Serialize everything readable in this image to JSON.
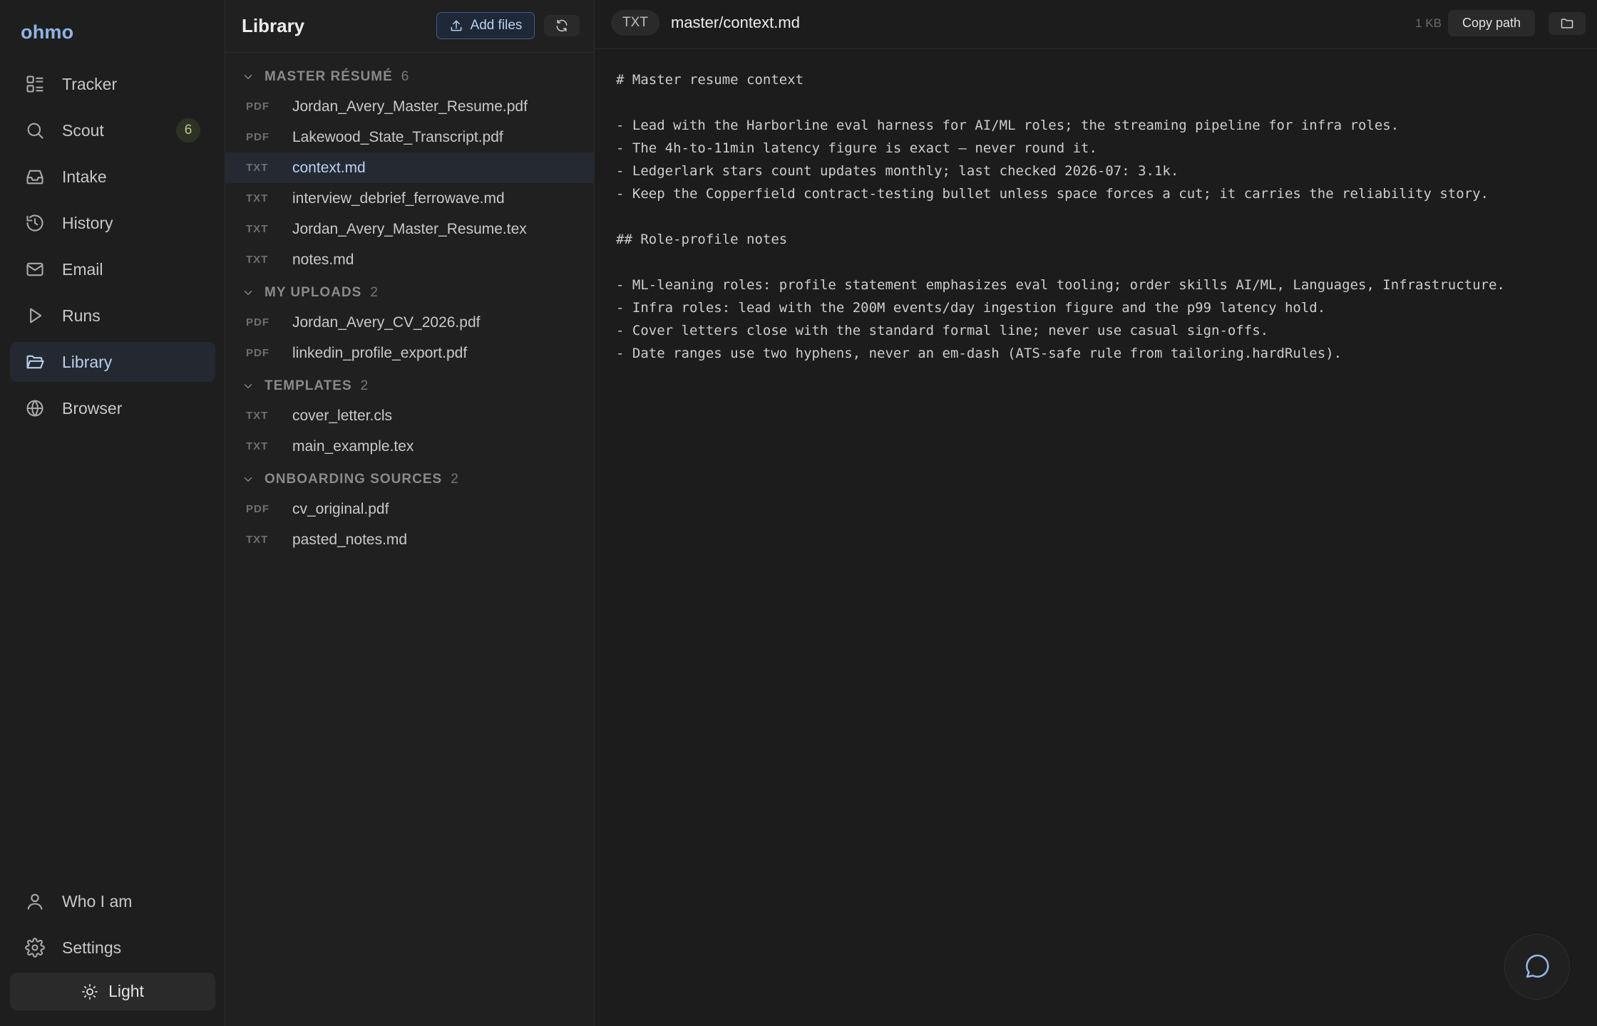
{
  "app": {
    "brand": "ohmo"
  },
  "nav": {
    "items": [
      {
        "label": "Tracker",
        "icon": "tracker-icon",
        "active": false
      },
      {
        "label": "Scout",
        "icon": "search-icon",
        "badge": "6",
        "active": false
      },
      {
        "label": "Intake",
        "icon": "inbox-icon",
        "active": false
      },
      {
        "label": "History",
        "icon": "history-icon",
        "active": false
      },
      {
        "label": "Email",
        "icon": "mail-icon",
        "active": false
      },
      {
        "label": "Runs",
        "icon": "play-icon",
        "active": false
      },
      {
        "label": "Library",
        "icon": "folder-open-icon",
        "active": true
      },
      {
        "label": "Browser",
        "icon": "globe-icon",
        "active": false
      }
    ],
    "bottom": [
      {
        "label": "Who I am",
        "icon": "user-icon"
      },
      {
        "label": "Settings",
        "icon": "gear-icon"
      }
    ],
    "theme_toggle": {
      "label": "Light",
      "icon": "sun-icon"
    }
  },
  "library": {
    "title": "Library",
    "add_files_label": "Add files",
    "groups": [
      {
        "name": "MASTER RÉSUMÉ",
        "count": "6",
        "files": [
          {
            "type": "PDF",
            "name": "Jordan_Avery_Master_Resume.pdf"
          },
          {
            "type": "PDF",
            "name": "Lakewood_State_Transcript.pdf"
          },
          {
            "type": "TXT",
            "name": "context.md",
            "selected": true
          },
          {
            "type": "TXT",
            "name": "interview_debrief_ferrowave.md"
          },
          {
            "type": "TXT",
            "name": "Jordan_Avery_Master_Resume.tex"
          },
          {
            "type": "TXT",
            "name": "notes.md"
          }
        ]
      },
      {
        "name": "MY UPLOADS",
        "count": "2",
        "files": [
          {
            "type": "PDF",
            "name": "Jordan_Avery_CV_2026.pdf"
          },
          {
            "type": "PDF",
            "name": "linkedin_profile_export.pdf"
          }
        ]
      },
      {
        "name": "TEMPLATES",
        "count": "2",
        "files": [
          {
            "type": "TXT",
            "name": "cover_letter.cls"
          },
          {
            "type": "TXT",
            "name": "main_example.tex"
          }
        ]
      },
      {
        "name": "ONBOARDING SOURCES",
        "count": "2",
        "files": [
          {
            "type": "PDF",
            "name": "cv_original.pdf"
          },
          {
            "type": "TXT",
            "name": "pasted_notes.md"
          }
        ]
      }
    ]
  },
  "viewer": {
    "type": "TXT",
    "path": "master/context.md",
    "size": "1 KB",
    "copy_path_label": "Copy path",
    "lines": [
      "# Master resume context",
      "",
      "- Lead with the Harborline eval harness for AI/ML roles; the streaming pipeline for infra roles.",
      "- The 4h-to-11min latency figure is exact — never round it.",
      "- Ledgerlark stars count updates monthly; last checked 2026-07: 3.1k.",
      "- Keep the Copperfield contract-testing bullet unless space forces a cut; it carries the reliability story.",
      "",
      "## Role-profile notes",
      "",
      "- ML-leaning roles: profile statement emphasizes eval tooling; order skills AI/ML, Languages, Infrastructure.",
      "- Infra roles: lead with the 200M events/day ingestion figure and the p99 latency hold.",
      "- Cover letters close with the standard formal line; never use casual sign-offs.",
      "- Date ranges use two hyphens, never an em-dash (ATS-safe rule from tailoring.hardRules)."
    ]
  }
}
